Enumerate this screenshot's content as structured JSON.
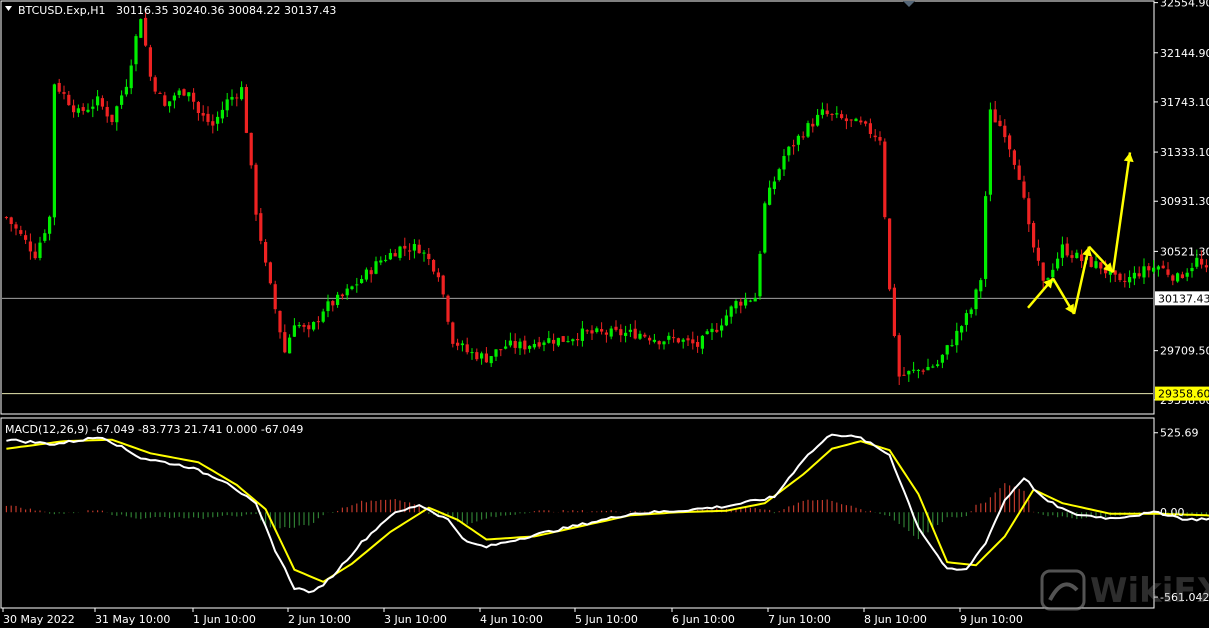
{
  "symbol_header": "BTCUSD.Exp,H1",
  "ohlc_text": "30116.35 30240.36 30084.22 30137.43",
  "macd_header": "MACD(12,26,9) -67.049 -83.773 21.741 0.000 -67.049",
  "watermark": "WikiFX",
  "colors": {
    "background": "#000000",
    "bull_candle": "#00ee00",
    "bear_candle": "#ee2222",
    "grid_border": "#ffffff",
    "macd_line": "#ffffff",
    "signal_line": "#ffff00",
    "hist_pos": "#c0392b",
    "hist_neg": "#2e7d32",
    "arrow": "#ffff00",
    "support_label_bg": "#ffff00"
  },
  "chart_data": [
    {
      "type": "candlestick",
      "title": "BTCUSD.Exp,H1",
      "price_ticks": [
        "32554.90",
        "32144.90",
        "31743.10",
        "31333.10",
        "30931.30",
        "30521.30",
        "29709.50",
        "29358.60"
      ],
      "price_tick_values": [
        32554.9,
        32144.9,
        31743.1,
        31333.1,
        30931.3,
        30521.3,
        29709.5,
        29307.7
      ],
      "ylim": [
        29200,
        32560
      ],
      "current_price_label": "30137.43",
      "current_price": 30137.43,
      "support_label": "29358.60",
      "support_price": 29358.6,
      "x_labels": [
        "30 May 2022",
        "31 May 10:00",
        "1 Jun 10:00",
        "2 Jun 10:00",
        "3 Jun 10:00",
        "4 Jun 10:00",
        "5 Jun 10:00",
        "6 Jun 10:00",
        "7 Jun 10:00",
        "8 Jun 10:00",
        "9 Jun 10:00"
      ],
      "anchors": [
        [
          0,
          30800
        ],
        [
          2,
          30700
        ],
        [
          4,
          30600
        ],
        [
          6,
          30500
        ],
        [
          9,
          30800
        ],
        [
          10,
          31900
        ],
        [
          12,
          31800
        ],
        [
          15,
          31650
        ],
        [
          19,
          31750
        ],
        [
          22,
          31600
        ],
        [
          25,
          31900
        ],
        [
          28,
          32450
        ],
        [
          30,
          31950
        ],
        [
          33,
          31700
        ],
        [
          35,
          31800
        ],
        [
          38,
          31850
        ],
        [
          40,
          31650
        ],
        [
          43,
          31550
        ],
        [
          46,
          31750
        ],
        [
          49,
          31850
        ],
        [
          52,
          30850
        ],
        [
          54,
          30400
        ],
        [
          56,
          30050
        ],
        [
          58,
          29700
        ],
        [
          60,
          29950
        ],
        [
          63,
          29850
        ],
        [
          66,
          30050
        ],
        [
          70,
          30150
        ],
        [
          74,
          30300
        ],
        [
          78,
          30450
        ],
        [
          82,
          30550
        ],
        [
          86,
          30550
        ],
        [
          90,
          30350
        ],
        [
          93,
          29800
        ],
        [
          96,
          29700
        ],
        [
          100,
          29650
        ],
        [
          104,
          29750
        ],
        [
          108,
          29750
        ],
        [
          112,
          29800
        ],
        [
          116,
          29800
        ],
        [
          120,
          29850
        ],
        [
          124,
          29850
        ],
        [
          128,
          29850
        ],
        [
          132,
          29850
        ],
        [
          136,
          29800
        ],
        [
          140,
          29800
        ],
        [
          144,
          29750
        ],
        [
          148,
          29900
        ],
        [
          152,
          30100
        ],
        [
          156,
          30150
        ],
        [
          158,
          30900
        ],
        [
          162,
          31300
        ],
        [
          166,
          31500
        ],
        [
          170,
          31650
        ],
        [
          174,
          31600
        ],
        [
          178,
          31550
        ],
        [
          182,
          31450
        ],
        [
          184,
          30200
        ],
        [
          186,
          29500
        ],
        [
          190,
          29550
        ],
        [
          194,
          29600
        ],
        [
          198,
          29850
        ],
        [
          201,
          30050
        ],
        [
          203,
          30300
        ],
        [
          205,
          31650
        ],
        [
          208,
          31500
        ],
        [
          211,
          31150
        ],
        [
          213,
          30700
        ],
        [
          216,
          30250
        ],
        [
          220,
          30550
        ],
        [
          224,
          30450
        ],
        [
          228,
          30400
        ],
        [
          232,
          30250
        ],
        [
          236,
          30350
        ],
        [
          240,
          30400
        ],
        [
          244,
          30300
        ],
        [
          248,
          30450
        ],
        [
          252,
          30250
        ],
        [
          256,
          30200
        ],
        [
          260,
          30150
        ],
        [
          264,
          30050
        ],
        [
          268,
          30100
        ],
        [
          271,
          30137
        ]
      ],
      "forecast_arrows_prices": [
        [
          30060,
          30300
        ],
        [
          30300,
          30010
        ],
        [
          30010,
          30560
        ],
        [
          30560,
          30350
        ],
        [
          30350,
          31330
        ]
      ]
    },
    {
      "type": "line",
      "title": "MACD(12,26,9)",
      "y_ticks": [
        "525.69",
        "0.00",
        "-561.042"
      ],
      "y_tick_values": [
        525.69,
        0,
        -561.042
      ],
      "ylim": [
        -620,
        610
      ],
      "macd_anchors": [
        [
          0,
          480
        ],
        [
          10,
          450
        ],
        [
          20,
          500
        ],
        [
          28,
          360
        ],
        [
          38,
          300
        ],
        [
          46,
          200
        ],
        [
          52,
          50
        ],
        [
          56,
          -250
        ],
        [
          60,
          -500
        ],
        [
          64,
          -530
        ],
        [
          68,
          -420
        ],
        [
          74,
          -200
        ],
        [
          80,
          -20
        ],
        [
          86,
          50
        ],
        [
          92,
          -50
        ],
        [
          96,
          -200
        ],
        [
          100,
          -230
        ],
        [
          110,
          -150
        ],
        [
          120,
          -80
        ],
        [
          130,
          -10
        ],
        [
          140,
          10
        ],
        [
          150,
          40
        ],
        [
          160,
          100
        ],
        [
          166,
          350
        ],
        [
          172,
          520
        ],
        [
          178,
          490
        ],
        [
          184,
          380
        ],
        [
          190,
          -100
        ],
        [
          196,
          -380
        ],
        [
          200,
          -380
        ],
        [
          204,
          -200
        ],
        [
          208,
          80
        ],
        [
          212,
          230
        ],
        [
          216,
          90
        ],
        [
          222,
          -10
        ],
        [
          230,
          -40
        ],
        [
          240,
          0
        ],
        [
          246,
          -50
        ],
        [
          256,
          -30
        ],
        [
          262,
          -70
        ],
        [
          268,
          -67
        ]
      ],
      "signal_anchors": [
        [
          0,
          420
        ],
        [
          12,
          470
        ],
        [
          22,
          480
        ],
        [
          30,
          390
        ],
        [
          40,
          330
        ],
        [
          48,
          180
        ],
        [
          54,
          20
        ],
        [
          60,
          -380
        ],
        [
          66,
          -460
        ],
        [
          72,
          -340
        ],
        [
          80,
          -130
        ],
        [
          88,
          30
        ],
        [
          94,
          -50
        ],
        [
          100,
          -180
        ],
        [
          110,
          -160
        ],
        [
          120,
          -90
        ],
        [
          130,
          -20
        ],
        [
          140,
          0
        ],
        [
          150,
          10
        ],
        [
          158,
          60
        ],
        [
          166,
          250
        ],
        [
          172,
          420
        ],
        [
          178,
          470
        ],
        [
          184,
          410
        ],
        [
          190,
          120
        ],
        [
          196,
          -330
        ],
        [
          202,
          -350
        ],
        [
          208,
          -160
        ],
        [
          214,
          150
        ],
        [
          220,
          60
        ],
        [
          230,
          -10
        ],
        [
          240,
          -10
        ],
        [
          250,
          -20
        ],
        [
          260,
          -55
        ],
        [
          268,
          -84
        ]
      ],
      "histogram_note": "MACD minus signal"
    }
  ]
}
